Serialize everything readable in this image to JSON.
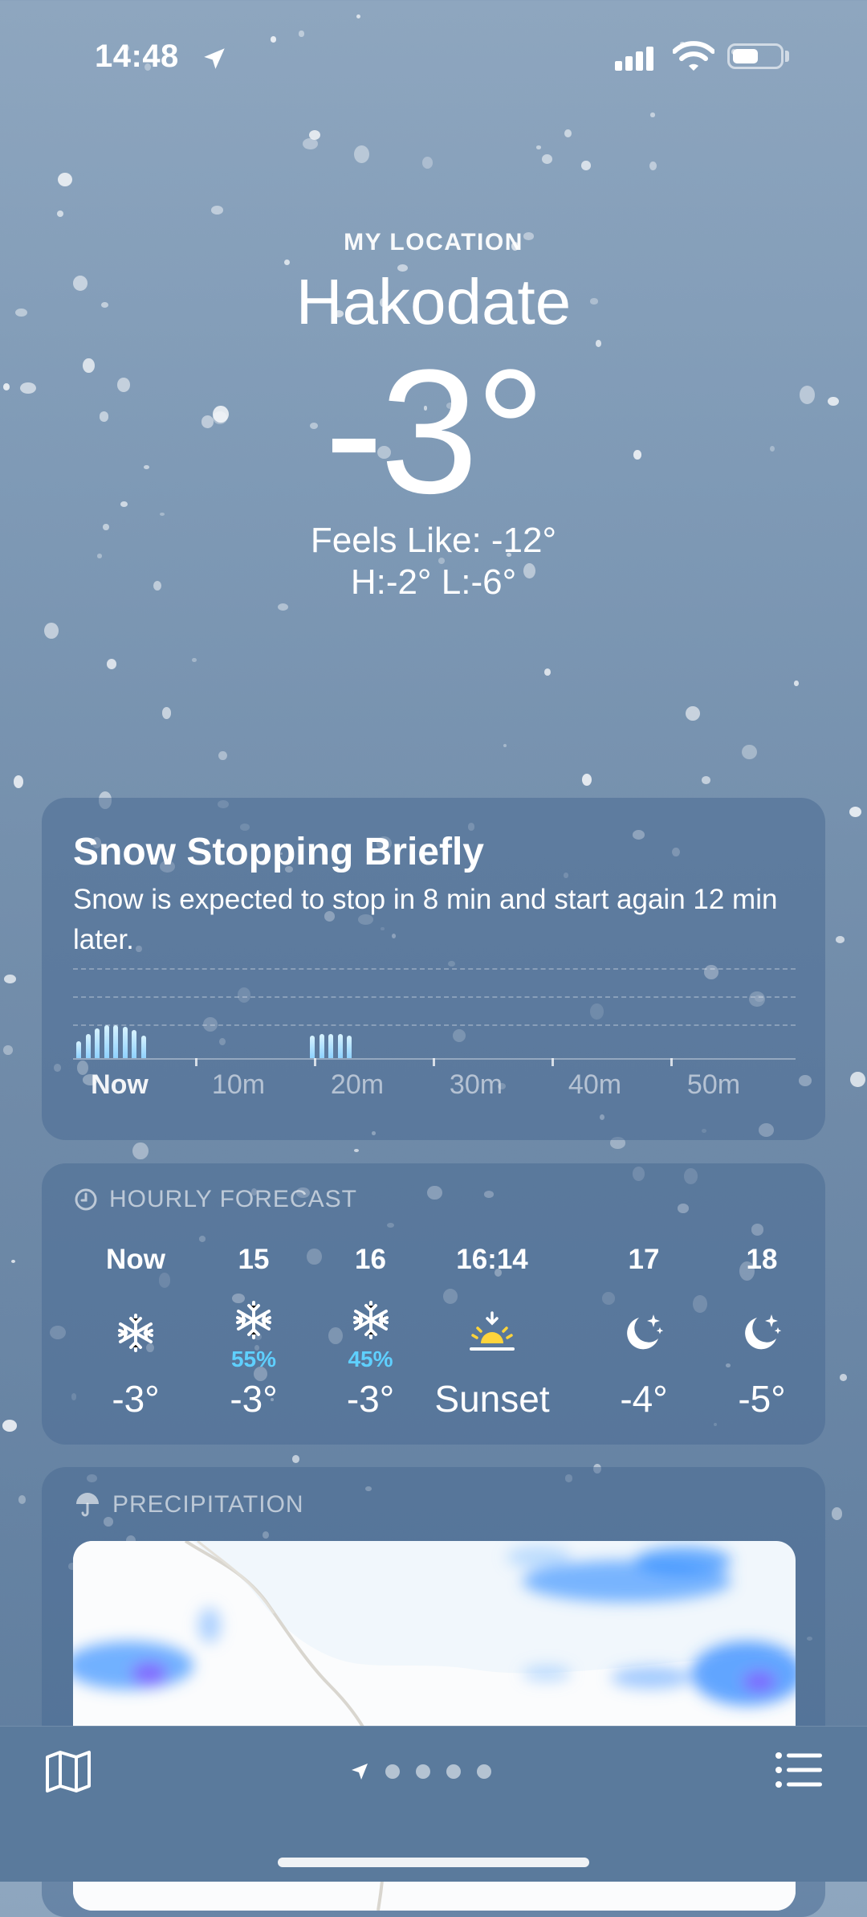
{
  "status_bar": {
    "time": "14:48",
    "battery_level": 0.55
  },
  "location": {
    "label": "MY LOCATION",
    "city": "Hakodate",
    "temperature": "-3°",
    "feels_like": "Feels Like: -12°",
    "high_low": "H:-2°  L:-6°"
  },
  "precip_card": {
    "title": "Snow Stopping Briefly",
    "description": "Snow is expected to stop in 8 min and start again 12 min later.",
    "time_labels": [
      "Now",
      "10m",
      "20m",
      "30m",
      "40m",
      "50m"
    ],
    "intensity": [
      0.45,
      0.65,
      0.8,
      0.9,
      0.9,
      0.85,
      0.75,
      0.6,
      0,
      0,
      0,
      0,
      0,
      0,
      0,
      0,
      0,
      0,
      0,
      0.6,
      0.65,
      0.65,
      0.65,
      0.6
    ]
  },
  "hourly": {
    "header": "HOURLY FORECAST",
    "items": [
      {
        "hour": "Now",
        "icon": "snowflake-icon",
        "pop": "",
        "temp": "-3°"
      },
      {
        "hour": "15",
        "icon": "snowflake-icon",
        "pop": "55%",
        "temp": "-3°"
      },
      {
        "hour": "16",
        "icon": "snowflake-icon",
        "pop": "45%",
        "temp": "-3°"
      },
      {
        "hour": "16:14",
        "icon": "sunset-icon",
        "pop": "",
        "temp": "Sunset"
      },
      {
        "hour": "17",
        "icon": "moon-stars-icon",
        "pop": "",
        "temp": "-4°"
      },
      {
        "hour": "18",
        "icon": "moon-stars-icon",
        "pop": "",
        "temp": "-5°"
      }
    ]
  },
  "precipitation": {
    "header": "PRECIPITATION"
  },
  "colors": {
    "accent_pop": "#5fd0ff",
    "bar_fill": "#8fd2ff",
    "sun": "#ffd43b"
  }
}
